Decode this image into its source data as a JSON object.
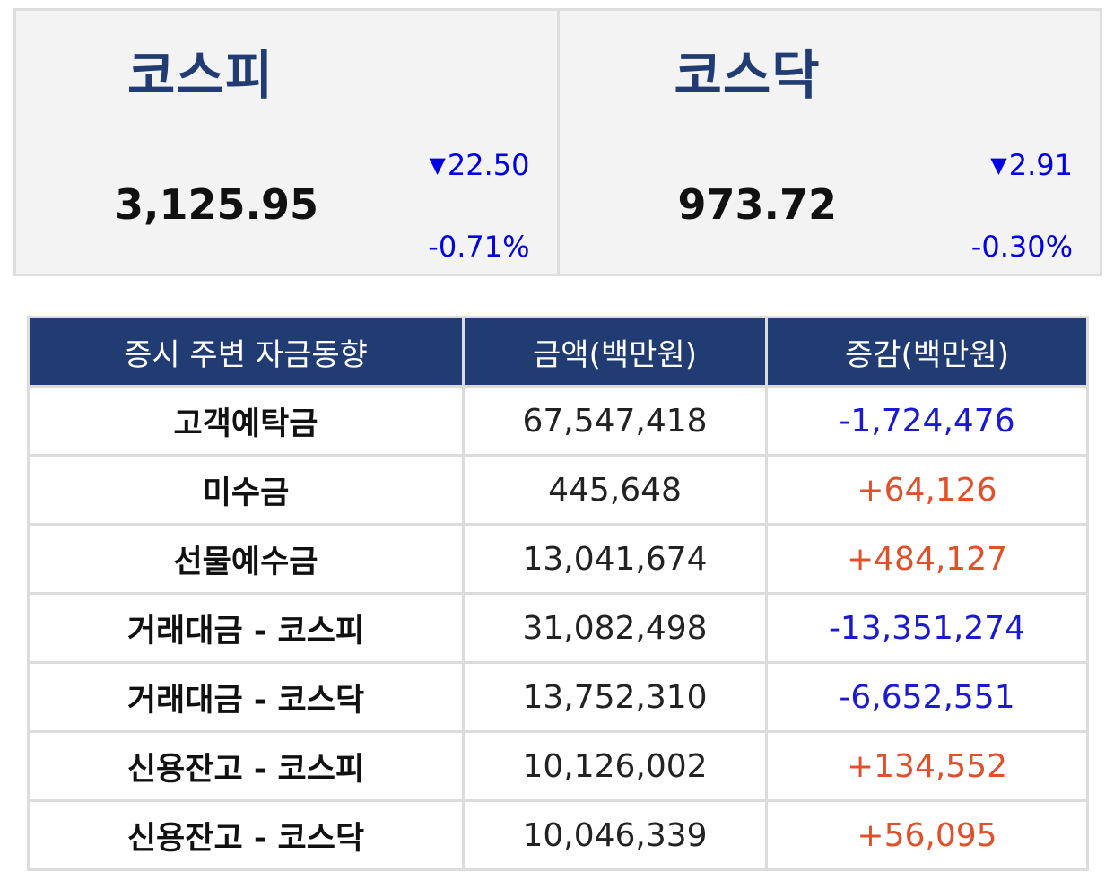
{
  "indices": [
    {
      "name": "코스피",
      "value": "3,125.95",
      "change": "22.50",
      "change_pct": "-0.71%",
      "direction_icon": "triangle-down-icon"
    },
    {
      "name": "코스닥",
      "value": "973.72",
      "change": "2.91",
      "change_pct": "-0.30%",
      "direction_icon": "triangle-down-icon"
    }
  ],
  "table": {
    "headers": [
      "증시 주변 자금동향",
      "금액(백만원)",
      "증감(백만원)"
    ],
    "rows": [
      {
        "label": "고객예탁금",
        "amount": "67,547,418",
        "change": "-1,724,476",
        "sign": "neg"
      },
      {
        "label": "미수금",
        "amount": "445,648",
        "change": "+64,126",
        "sign": "pos"
      },
      {
        "label": "선물예수금",
        "amount": "13,041,674",
        "change": "+484,127",
        "sign": "pos"
      },
      {
        "label": "거래대금 - 코스피",
        "amount": "31,082,498",
        "change": "-13,351,274",
        "sign": "neg"
      },
      {
        "label": "거래대금 - 코스닥",
        "amount": "13,752,310",
        "change": "-6,652,551",
        "sign": "neg"
      },
      {
        "label": "신용잔고 - 코스피",
        "amount": "10,126,002",
        "change": "+134,552",
        "sign": "pos"
      },
      {
        "label": "신용잔고 - 코스닥",
        "amount": "10,046,339",
        "change": "+56,095",
        "sign": "pos"
      }
    ]
  },
  "colors": {
    "header_bg": "#213c73",
    "index_name": "#213c73",
    "negative": "#1a1ad0",
    "positive": "#e0502a",
    "panel_bg": "#f3f3f3",
    "border": "#dcdcdc"
  }
}
